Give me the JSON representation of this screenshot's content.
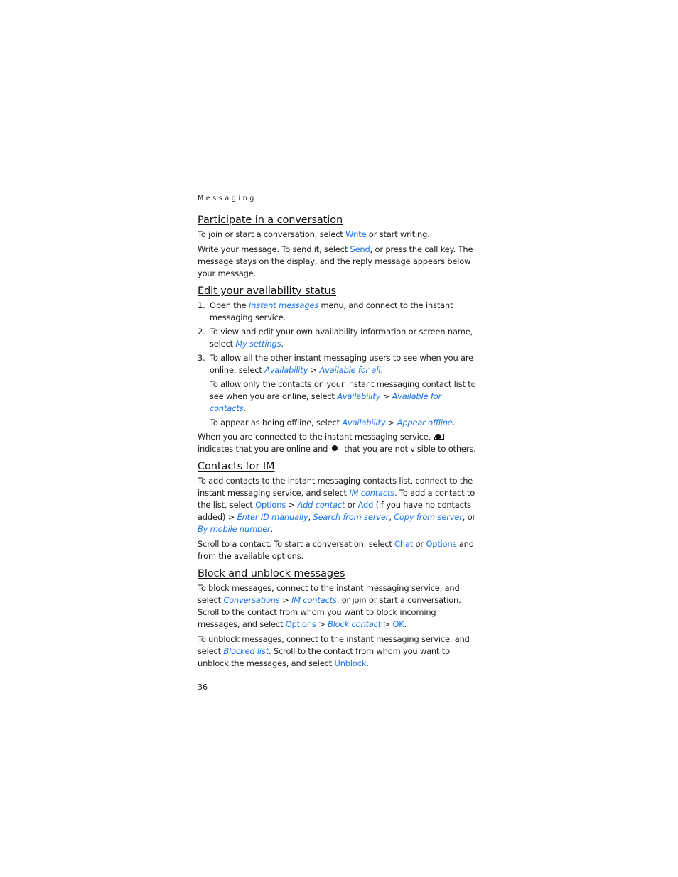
{
  "running_head": "Messaging",
  "page_number": "36",
  "colors": {
    "link": "#1a73e8",
    "text": "#1a1a1a"
  },
  "sections": {
    "participate": {
      "title": "Participate in a conversation",
      "p1": {
        "a": "To join or start a conversation, select ",
        "k1": "Write",
        "b": " or start writing."
      },
      "p2": {
        "a": "Write your message. To send it, select ",
        "k1": "Send",
        "b": ", or press the call key. The message stays on the display, and the reply message appears below your message."
      }
    },
    "availability": {
      "title": "Edit your availability status",
      "items": [
        {
          "num": "1.",
          "a": "Open the ",
          "i1": "Instant messages",
          "b": " menu, and connect to the instant messaging service."
        },
        {
          "num": "2.",
          "a": "To view and edit your own availability information or screen name, select ",
          "i1": "My settings",
          "b": "."
        },
        {
          "num": "3.",
          "a": "To allow all the other instant messaging users to see when you are online, select ",
          "i1": "Availability",
          "sep": " > ",
          "i2": "Available for all",
          "b": ".",
          "sub1": {
            "a": "To allow only the contacts on your instant messaging contact list to see when you are online, select ",
            "i1": "Availability",
            "sep": " > ",
            "i2": "Available for contacts",
            "b": "."
          },
          "sub2": {
            "a": "To appear as being offline, select ",
            "i1": "Availability",
            "sep": " > ",
            "i2": "Appear offline",
            "b": "."
          }
        }
      ],
      "status": {
        "a": "When you are connected to the instant messaging service, ",
        "icon1": "online-status-icon",
        "b": " indicates that you are online and ",
        "icon2": "hidden-status-icon",
        "c": " that you are not visible to others."
      }
    },
    "contacts": {
      "title": "Contacts for IM",
      "p1": {
        "a": "To add contacts to the instant messaging contacts list, connect to the instant messaging service, and select ",
        "i1": "IM contacts",
        "b": ". To add a contact to the list, select ",
        "k1": "Options",
        "sep1": " > ",
        "i2": "Add contact",
        "c": " or ",
        "k2": "Add",
        "d": " (if you have no contacts added) > ",
        "i3": "Enter ID manually",
        "e": ", ",
        "i4": "Search from server",
        "f": ", ",
        "i5": "Copy from server",
        "g": ", or ",
        "i6": "By mobile number",
        "h": "."
      },
      "p2": {
        "a": "Scroll to a contact. To start a conversation, select ",
        "k1": "Chat",
        "b": " or ",
        "k2": "Options",
        "c": " and from the available options."
      }
    },
    "block": {
      "title": "Block and unblock messages",
      "p1": {
        "a": "To block messages, connect to the instant messaging service, and select ",
        "i1": "Conversations",
        "sep1": " > ",
        "i2": "IM contacts",
        "b": ", or join or start a conversation. Scroll to the contact from whom you want to block incoming messages, and select ",
        "k1": "Options",
        "sep2": " > ",
        "i3": "Block contact",
        "sep3": " > ",
        "k2": "OK",
        "c": "."
      },
      "p2": {
        "a": "To unblock messages, connect to the instant messaging service, and select ",
        "i1": "Blocked list",
        "b": ". Scroll to the contact from whom you want to unblock the messages, and select ",
        "k1": "Unblock",
        "c": "."
      }
    }
  }
}
